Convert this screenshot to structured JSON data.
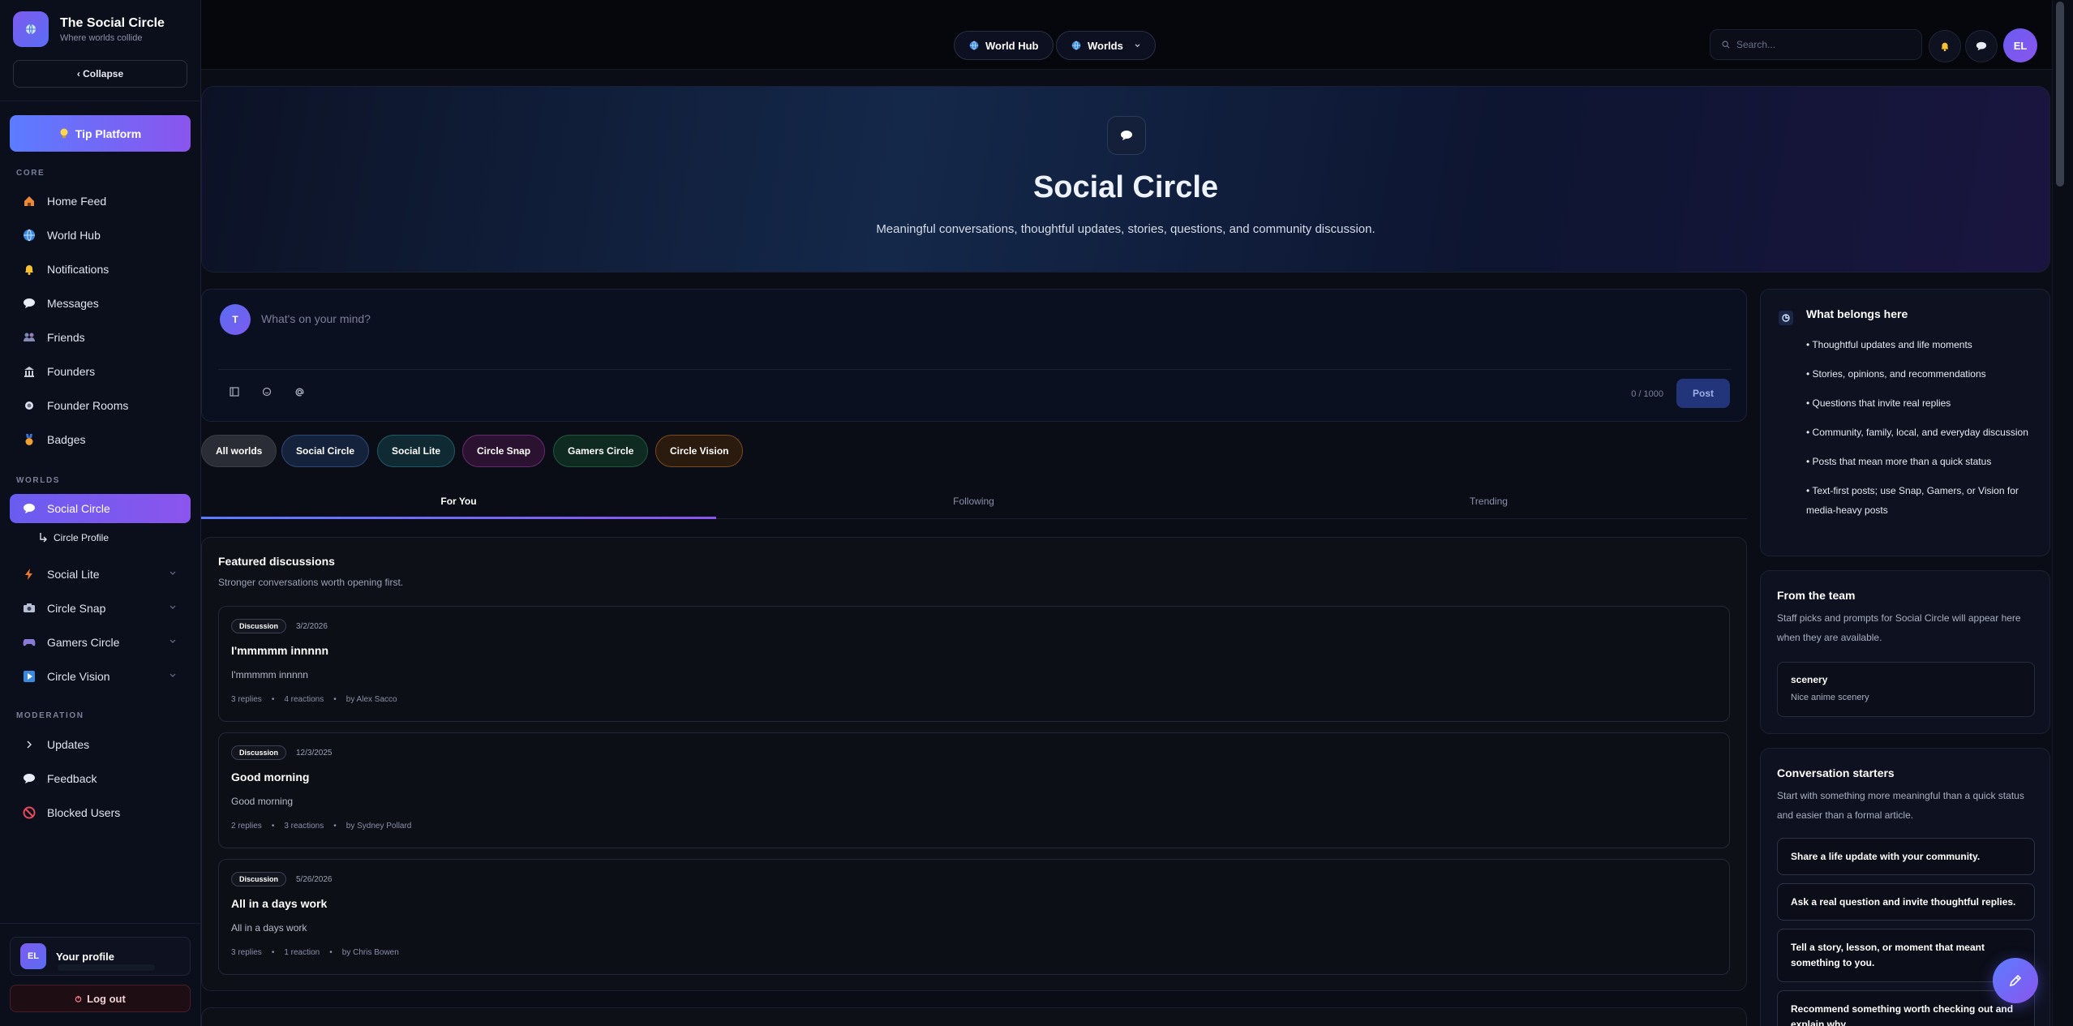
{
  "brand": {
    "name": "The Social Circle",
    "tagline": "Where worlds collide"
  },
  "sidebar": {
    "collapse_label": "‹ Collapse",
    "tip_label": "Tip Platform",
    "core_label": "CORE",
    "core_items": [
      {
        "label": "Home Feed",
        "icon": "home-icon"
      },
      {
        "label": "World Hub",
        "icon": "globe-icon"
      },
      {
        "label": "Notifications",
        "icon": "bell-icon"
      },
      {
        "label": "Messages",
        "icon": "chat-icon"
      },
      {
        "label": "Friends",
        "icon": "friends-icon"
      },
      {
        "label": "Founders",
        "icon": "building-icon"
      },
      {
        "label": "Founder Rooms",
        "icon": "dot-icon"
      },
      {
        "label": "Badges",
        "icon": "medal-icon"
      }
    ],
    "worlds_label": "WORLDS",
    "world_items": [
      {
        "label": "Social Circle",
        "icon": "chat-icon",
        "active": true
      },
      {
        "label": "Social Lite",
        "icon": "lightning-icon"
      },
      {
        "label": "Circle Snap",
        "icon": "camera-icon"
      },
      {
        "label": "Gamers Circle",
        "icon": "gamepad-icon"
      },
      {
        "label": "Circle Vision",
        "icon": "play-icon"
      }
    ],
    "sub_item": "Circle Profile",
    "moderation_label": "MODERATION",
    "moderation_items": [
      {
        "label": "Updates",
        "icon": "chevron-right-icon"
      },
      {
        "label": "Feedback",
        "icon": "chat-icon"
      },
      {
        "label": "Blocked Users",
        "icon": "blocked-icon"
      }
    ],
    "profile": {
      "initials": "EL",
      "label": "Your profile"
    },
    "logout_label": "Log out"
  },
  "topbar": {
    "world_hub_label": "World Hub",
    "worlds_label": "Worlds",
    "search_placeholder": "Search...",
    "avatar_initials": "EL"
  },
  "hero": {
    "title": "Social Circle",
    "subtitle": "Meaningful conversations, thoughtful updates, stories, questions, and community discussion."
  },
  "composer": {
    "avatar_initial": "T",
    "placeholder": "What's on your mind?",
    "char_count": "0 / 1000",
    "post_label": "Post"
  },
  "world_filters": [
    {
      "label": "All worlds",
      "bg": "#2a2d36",
      "border": "#3a3d48"
    },
    {
      "label": "Social Circle",
      "bg": "#15223c",
      "border": "#2e4a7a"
    },
    {
      "label": "Social Lite",
      "bg": "#102a33",
      "border": "#1f5a66"
    },
    {
      "label": "Circle Snap",
      "bg": "#2b1230",
      "border": "#6a2a70"
    },
    {
      "label": "Gamers Circle",
      "bg": "#0f2a20",
      "border": "#1f5a40"
    },
    {
      "label": "Circle Vision",
      "bg": "#2b1a0e",
      "border": "#7a4a1f"
    }
  ],
  "feed_tabs": [
    "For You",
    "Following",
    "Trending"
  ],
  "featured": {
    "title": "Featured discussions",
    "subtitle": "Stronger conversations worth opening first.",
    "posts": [
      {
        "badge": "Discussion",
        "date": "3/2/2026",
        "title": "I'mmmmm innnnn",
        "body": "I'mmmmm innnnn",
        "replies": "3 replies",
        "reactions": "4 reactions",
        "author": "by Alex Sacco"
      },
      {
        "badge": "Discussion",
        "date": "12/3/2025",
        "title": "Good morning",
        "body": "Good morning",
        "replies": "2 replies",
        "reactions": "3 reactions",
        "author": "by Sydney Pollard"
      },
      {
        "badge": "Discussion",
        "date": "5/26/2026",
        "title": "All in a days work",
        "body": "All in a days work",
        "replies": "3 replies",
        "reactions": "1 reaction",
        "author": "by Chris Bowen"
      }
    ]
  },
  "belongs": {
    "title": "What belongs here",
    "items": [
      "• Thoughtful updates and life moments",
      "• Stories, opinions, and recommendations",
      "• Questions that invite real replies",
      "• Community, family, local, and everyday discussion",
      "• Posts that mean more than a quick status",
      "• Text-first posts; use Snap, Gamers, or Vision for media-heavy posts"
    ]
  },
  "team": {
    "title": "From the team",
    "body": "Staff picks and prompts for Social Circle will appear here when they are available.",
    "pick_title": "scenery",
    "pick_body": "Nice anime scenery"
  },
  "starters": {
    "title": "Conversation starters",
    "body": "Start with something more meaningful than a quick status and easier than a formal article.",
    "items": [
      "Share a life update with your community.",
      "Ask a real question and invite thoughtful replies.",
      "Tell a story, lesson, or moment that meant something to you.",
      "Recommend something worth checking out and explain why."
    ]
  },
  "colors": {
    "accent": "#6a5cf0",
    "accent2": "#8a55ee",
    "blue": "#5b7cff"
  }
}
